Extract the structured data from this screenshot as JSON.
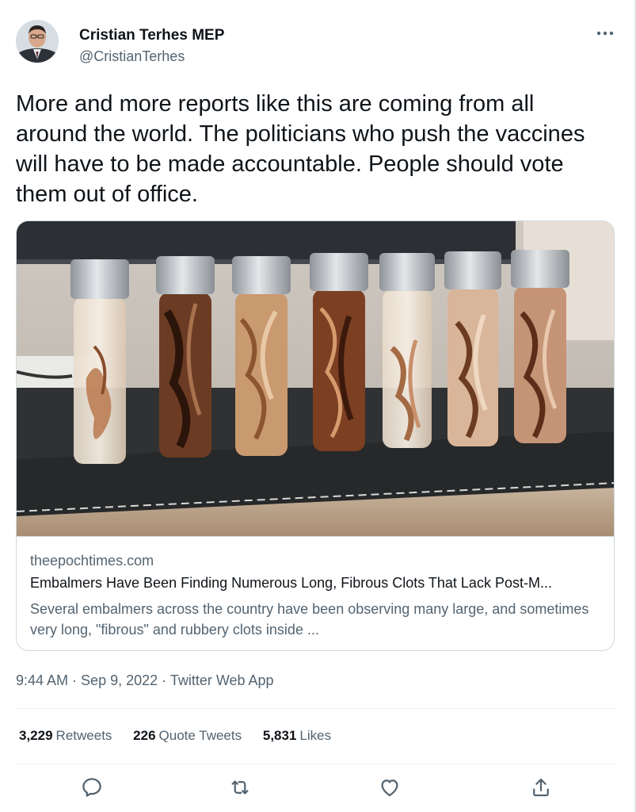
{
  "author": {
    "name": "Cristian Terhes MEP",
    "handle": "@CristianTerhes"
  },
  "icons": {
    "more": "more-horizontal-icon",
    "reply": "reply-icon",
    "retweet": "retweet-icon",
    "like": "heart-icon",
    "share": "share-icon"
  },
  "tweet": {
    "text": "More and more reports like this are coming from all around the world. The politicians who push the vaccines will have to be made accountable. People should vote them out of office."
  },
  "card": {
    "domain": "theepochtimes.com",
    "title": "Embalmers Have Been Finding Numerous Long, Fibrous Clots That Lack Post-M...",
    "description": "Several embalmers across the country have been observing many large, and sometimes very long, \"fibrous\" and rubbery clots inside ..."
  },
  "meta": {
    "time": "9:44 AM",
    "separator": " · ",
    "date": "Sep 9, 2022",
    "source": "Twitter Web App"
  },
  "stats": {
    "retweets_count": "3,229",
    "retweets_label": "Retweets",
    "quotes_count": "226",
    "quotes_label": "Quote Tweets",
    "likes_count": "5,831",
    "likes_label": "Likes"
  },
  "colors": {
    "text": "#0f1419",
    "secondary": "#536471",
    "border": "#cfd9de",
    "divider": "#eff3f4"
  }
}
